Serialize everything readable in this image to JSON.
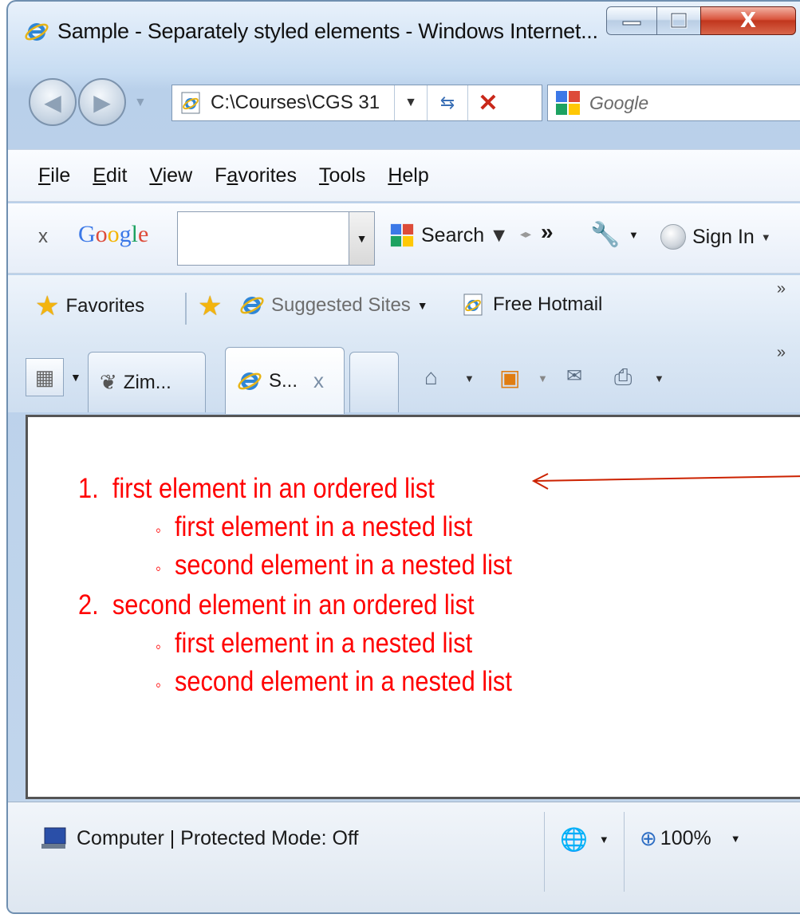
{
  "window": {
    "title": "Sample - Separately styled elements - Windows Internet...",
    "min_label": "—",
    "max_label": "◻",
    "close_label": "X"
  },
  "nav": {
    "address": "C:\\Courses\\CGS 31",
    "search_placeholder": "Google"
  },
  "menu": {
    "items": [
      {
        "key": "F",
        "rest": "ile"
      },
      {
        "key": "E",
        "rest": "dit"
      },
      {
        "key": "V",
        "rest": "iew"
      },
      {
        "pre": "F",
        "key": "a",
        "rest": "vorites"
      },
      {
        "key": "T",
        "rest": "ools"
      },
      {
        "key": "H",
        "rest": "elp"
      }
    ]
  },
  "google_toolbar": {
    "close": "x",
    "logo": "Google",
    "search_label": "Search",
    "more": "»",
    "signin": "Sign In"
  },
  "favorites_bar": {
    "favorites": "Favorites",
    "suggested": "Suggested Sites",
    "hotmail": "Free Hotmail",
    "chevron": "»"
  },
  "tabs": {
    "items": [
      {
        "label": "Zim..."
      },
      {
        "label": "S...",
        "close": "x"
      }
    ],
    "chevron": "»"
  },
  "content": {
    "list": [
      {
        "marker": "1.",
        "text": "first element in an ordered list"
      },
      {
        "marker": "◦",
        "text": "first element in a nested list"
      },
      {
        "marker": "◦",
        "text": "second element in a nested list"
      },
      {
        "marker": "2.",
        "text": "second element in an ordered list"
      },
      {
        "marker": "◦",
        "text": "first element in a nested list"
      },
      {
        "marker": "◦",
        "text": "second element in a nested list"
      }
    ],
    "text_color": "#ff0000",
    "arrow_color": "#cc2200"
  },
  "status": {
    "zone": "Computer | Protected Mode: Off",
    "zoom": "100%"
  }
}
